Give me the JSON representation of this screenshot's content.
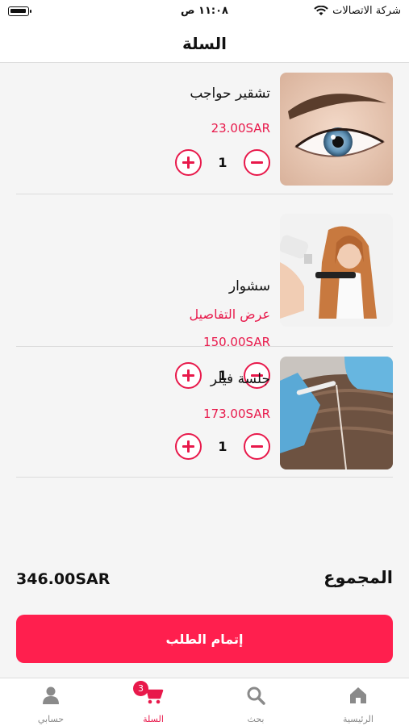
{
  "status": {
    "carrier": "شركة الاتصالات",
    "time": "١١:٠٨ ص"
  },
  "header": {
    "title": "السلة"
  },
  "items": [
    {
      "name": "تشقير حواجب",
      "link": "",
      "price": "23.00SAR",
      "qty": "1"
    },
    {
      "name": "سشوار",
      "link": "عرض التفاصيل",
      "price": "150.00SAR",
      "qty": "1"
    },
    {
      "name": "جلسة فيلر",
      "link": "",
      "price": "173.00SAR",
      "qty": "1"
    }
  ],
  "summary": {
    "total_label": "المجموع",
    "total_value": "346.00SAR"
  },
  "checkout": {
    "label": "إتمام الطلب"
  },
  "tabs": [
    {
      "label": "الرئيسية",
      "icon": "home-icon"
    },
    {
      "label": "بحث",
      "icon": "search-icon"
    },
    {
      "label": "السلة",
      "icon": "cart-icon",
      "badge": "3"
    },
    {
      "label": "حسابي",
      "icon": "user-icon"
    }
  ],
  "colors": {
    "accent": "#e8194b",
    "button": "#ff1f4e"
  }
}
